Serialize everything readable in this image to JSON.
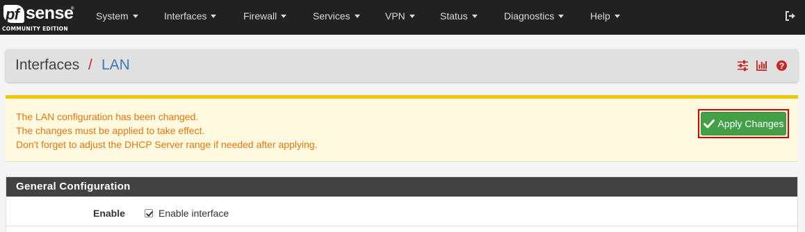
{
  "brand": {
    "logo_pf": "pf",
    "logo_sense": "sense",
    "trademark": "®",
    "edition": "COMMUNITY EDITION"
  },
  "nav": {
    "items": [
      {
        "label": "System"
      },
      {
        "label": "Interfaces"
      },
      {
        "label": "Firewall"
      },
      {
        "label": "Services"
      },
      {
        "label": "VPN"
      },
      {
        "label": "Status"
      },
      {
        "label": "Diagnostics"
      },
      {
        "label": "Help"
      }
    ],
    "logout_icon": "sign-out-icon"
  },
  "header": {
    "crumb_parent": "Interfaces",
    "separator": "/",
    "crumb_current": "LAN",
    "icons": [
      "sliders-icon",
      "bar-chart-icon",
      "help-circle-icon"
    ]
  },
  "alert": {
    "lines": [
      "The LAN configuration has been changed.",
      "The changes must be applied to take effect.",
      "Don't forget to adjust the DHCP Server range if needed after applying."
    ],
    "apply_label": "Apply Changes",
    "apply_icon": "check-icon"
  },
  "general": {
    "title": "General Configuration",
    "enable_label": "Enable",
    "enable_checkbox_label": "Enable interface",
    "enable_checked": true
  },
  "colors": {
    "navbar": "#212121",
    "alert_text": "#e8760c",
    "alert_border": "#f0ca00",
    "apply_button": "#43a047",
    "accent_red": "#c62828",
    "link_blue": "#3c78b5"
  }
}
